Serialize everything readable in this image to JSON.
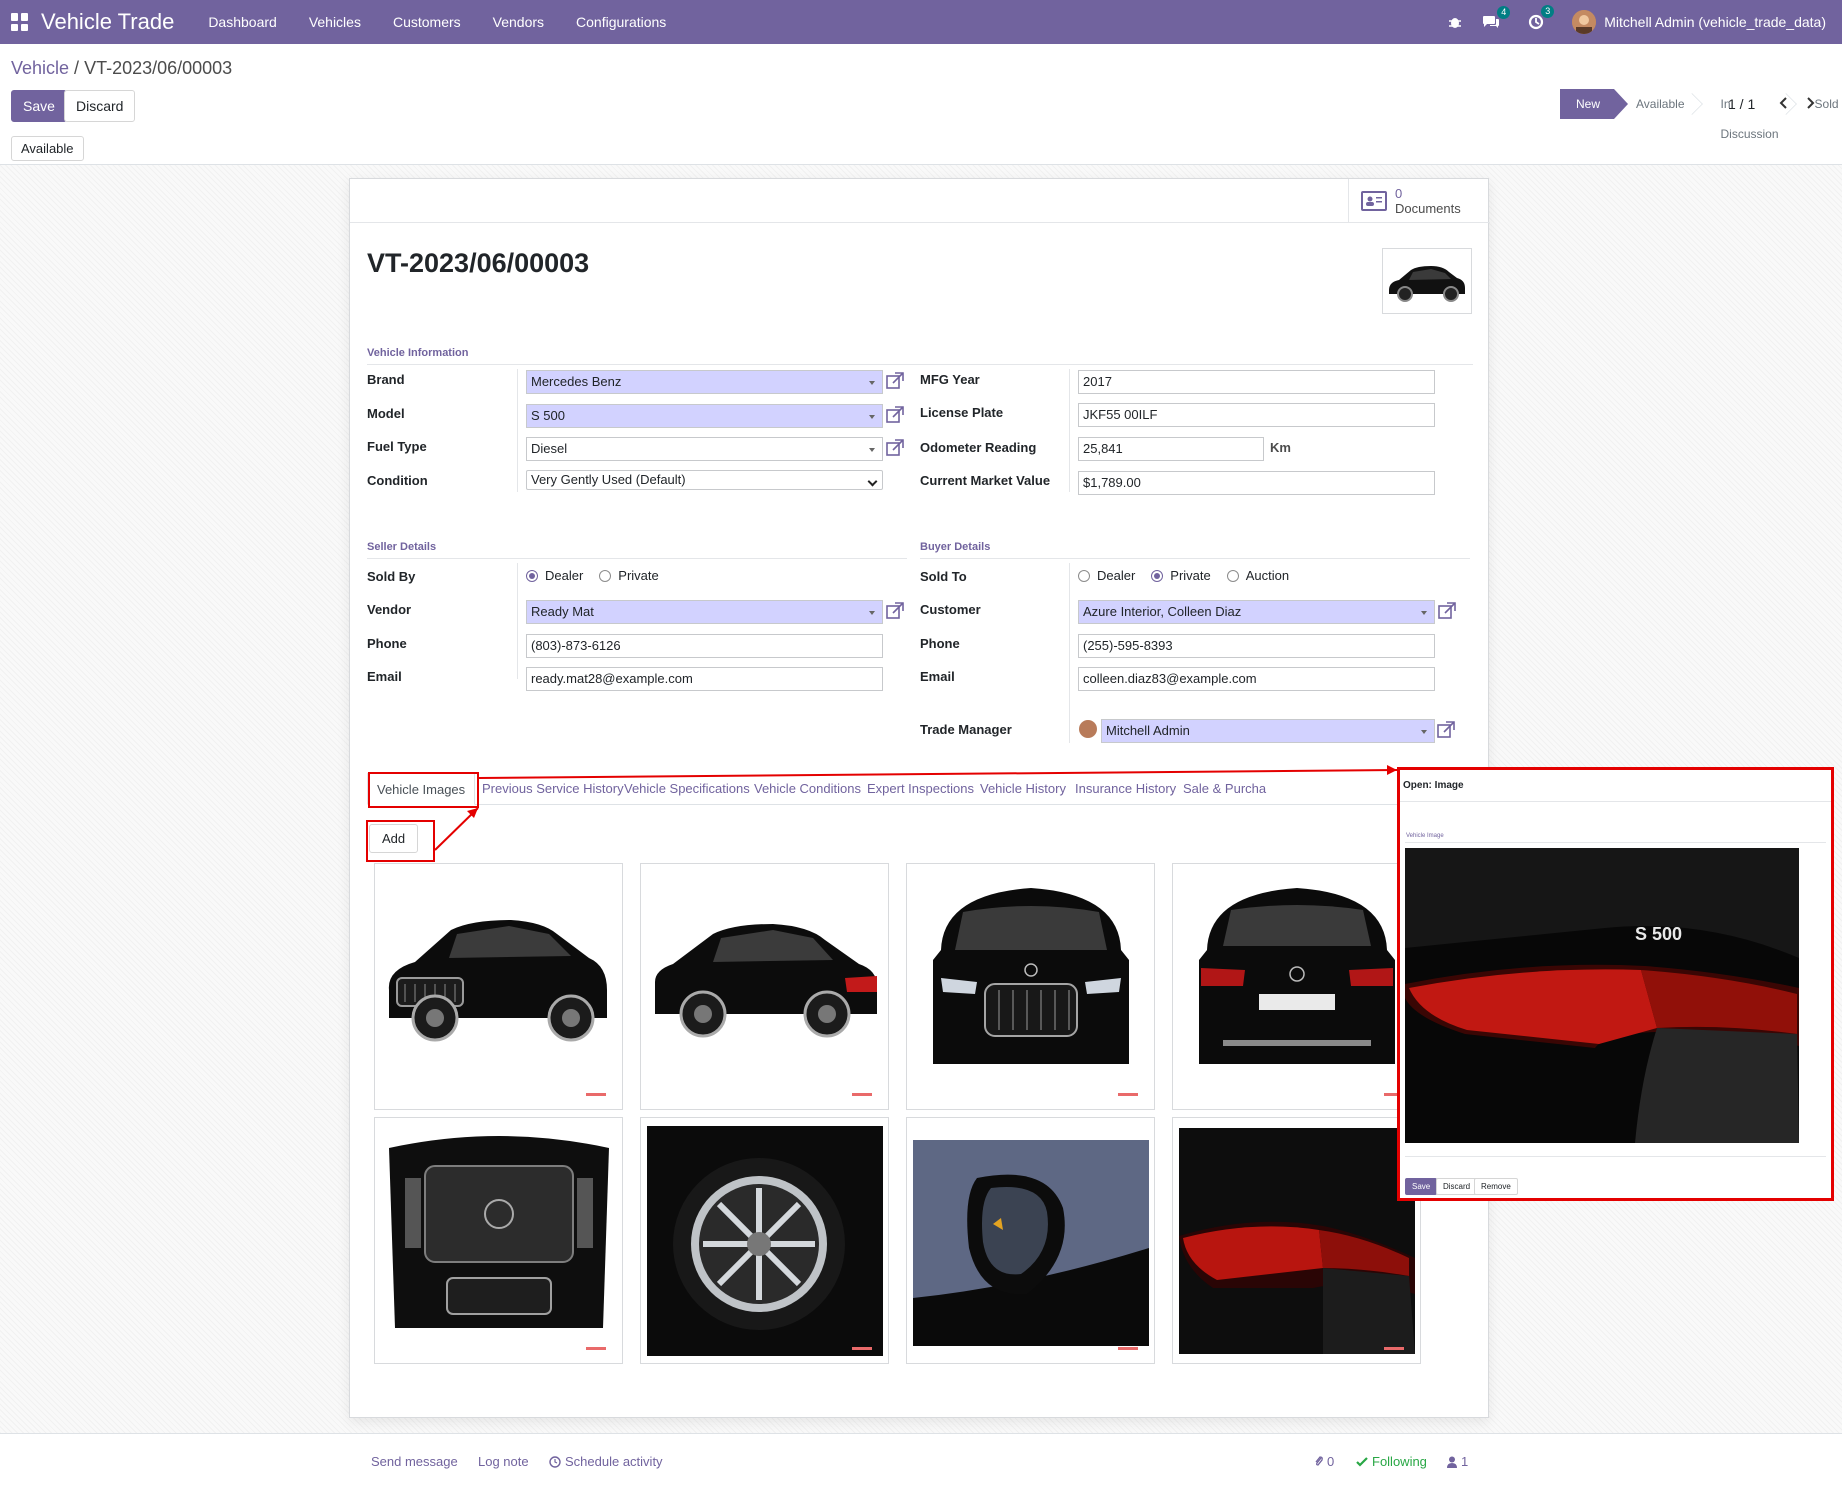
{
  "navbar": {
    "app_title": "Vehicle Trade",
    "menu": [
      "Dashboard",
      "Vehicles",
      "Customers",
      "Vendors",
      "Configurations"
    ],
    "messages_badge": "4",
    "activities_badge": "3",
    "user": "Mitchell Admin (vehicle_trade_data)"
  },
  "control_panel": {
    "breadcrumb_parent": "Vehicle",
    "breadcrumb_sep": " / ",
    "breadcrumb_current": "VT-2023/06/00003",
    "save_label": "Save",
    "discard_label": "Discard",
    "pager": "1 / 1",
    "status_button": "Available",
    "stages": [
      "New",
      "Available",
      "In Discussion",
      "Sold"
    ],
    "active_stage": "New"
  },
  "smart_button": {
    "count": "0",
    "label": "Documents"
  },
  "record": {
    "title": "VT-2023/06/00003",
    "vehicle_information": {
      "section_title": "Vehicle Information",
      "brand_label": "Brand",
      "brand": "Mercedes Benz",
      "model_label": "Model",
      "model": "S 500",
      "fuel_label": "Fuel Type",
      "fuel": "Diesel",
      "condition_label": "Condition",
      "condition": "Very Gently Used (Default)",
      "mfg_year_label": "MFG Year",
      "mfg_year": "2017",
      "plate_label": "License Plate",
      "plate": "JKF55 00ILF",
      "odometer_label": "Odometer Reading",
      "odometer": "25,841",
      "odometer_unit": "Km",
      "market_value_label": "Current Market Value",
      "market_value": "$1,789.00"
    },
    "seller": {
      "section_title": "Seller Details",
      "sold_by_label": "Sold By",
      "sold_by_options": [
        "Dealer",
        "Private"
      ],
      "sold_by_selected": "Dealer",
      "vendor_label": "Vendor",
      "vendor": "Ready Mat",
      "phone_label": "Phone",
      "phone": "(803)-873-6126",
      "email_label": "Email",
      "email": "ready.mat28@example.com"
    },
    "buyer": {
      "section_title": "Buyer Details",
      "sold_to_label": "Sold To",
      "sold_to_options": [
        "Dealer",
        "Private",
        "Auction"
      ],
      "sold_to_selected": "Private",
      "customer_label": "Customer",
      "customer": "Azure Interior, Colleen Diaz",
      "phone_label": "Phone",
      "phone": "(255)-595-8393",
      "email_label": "Email",
      "email": "colleen.diaz83@example.com",
      "trade_manager_label": "Trade Manager",
      "trade_manager": "Mitchell Admin"
    }
  },
  "tabs": [
    "Vehicle Images",
    "Previous Service History",
    "Vehicle Specifications",
    "Vehicle Conditions",
    "Expert Inspections",
    "Vehicle History",
    "Insurance History",
    "Sale & Purcha"
  ],
  "active_tab": "Vehicle Images",
  "add_label": "Add",
  "image_icons": [
    "car-front-angle-image",
    "car-rear-angle-image",
    "car-front-image",
    "car-rear-image",
    "car-engine-image",
    "car-wheel-image",
    "car-mirror-image",
    "car-taillight-image"
  ],
  "dialog": {
    "title": "Open: Image",
    "section": "Vehicle Image",
    "save_label": "Save",
    "discard_label": "Discard",
    "remove_label": "Remove",
    "badge_text": "S 500"
  },
  "chatter": {
    "send_message": "Send message",
    "log_note": "Log note",
    "schedule_activity": "Schedule activity",
    "attachments": "0",
    "following": "Following",
    "followers": "1"
  },
  "colors": {
    "brand": "#71639e",
    "required_field": "#d2d2ff",
    "annotation": "#e40000",
    "success": "#28a745"
  }
}
